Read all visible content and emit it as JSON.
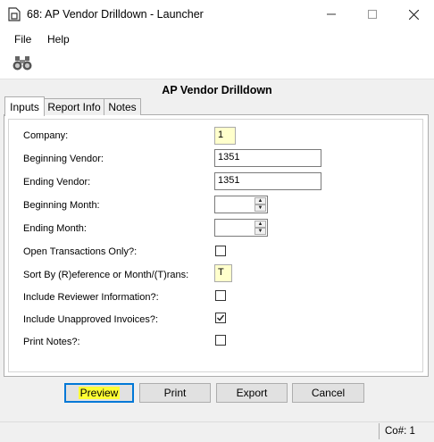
{
  "window": {
    "title": "68: AP Vendor Drilldown - Launcher",
    "icon": "app-doc-icon",
    "controls": [
      "minimize-icon",
      "maximize-icon",
      "close-icon"
    ]
  },
  "menu": {
    "items": [
      "File",
      "Help"
    ]
  },
  "toolbar": {
    "icons": [
      "binoculars-icon"
    ]
  },
  "form": {
    "title": "AP Vendor Drilldown"
  },
  "tabs": [
    {
      "label": "Inputs",
      "active": true
    },
    {
      "label": "Report Info",
      "active": false
    },
    {
      "label": "Notes",
      "active": false
    }
  ],
  "fields": {
    "company": {
      "label": "Company:",
      "value": "1"
    },
    "beginning_vendor": {
      "label": "Beginning Vendor:",
      "value": "1351"
    },
    "ending_vendor": {
      "label": "Ending Vendor:",
      "value": "1351"
    },
    "beginning_month": {
      "label": "Beginning Month:",
      "value": ""
    },
    "ending_month": {
      "label": "Ending Month:",
      "value": ""
    },
    "open_transactions": {
      "label": "Open Transactions Only?:",
      "checked": false
    },
    "sort_by": {
      "label": "Sort By (R)eference or Month/(T)rans:",
      "value": "T"
    },
    "include_reviewer": {
      "label": "Include Reviewer Information?:",
      "checked": false
    },
    "include_unapproved": {
      "label": "Include Unapproved Invoices?:",
      "checked": true
    },
    "print_notes": {
      "label": "Print Notes?:",
      "checked": false
    }
  },
  "buttons": {
    "preview": "Preview",
    "print": "Print",
    "export": "Export",
    "cancel": "Cancel"
  },
  "status": {
    "company": "Co#: 1"
  },
  "colors": {
    "highlight": "#ffff33",
    "focus_border": "#0078d7",
    "input_yellow": "#ffffcc"
  }
}
